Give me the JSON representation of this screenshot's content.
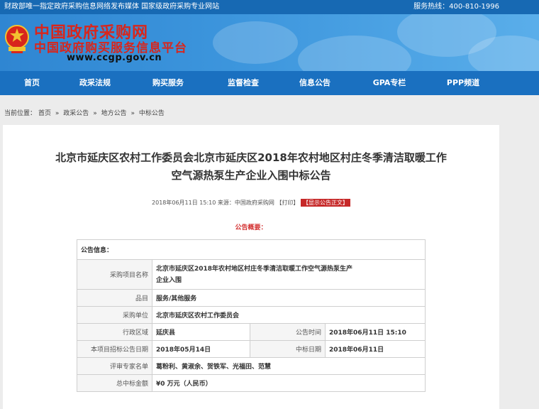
{
  "topbar": {
    "left_text": "财政部唯一指定政府采购信息网络发布媒体  国家级政府采购专业网站",
    "right_text": "服务热线：400-810-1996"
  },
  "logo": {
    "line1": "中国政府采购网",
    "line2": "中国政府购买服务信息平台",
    "url": "www.ccgp.gov.cn"
  },
  "nav": {
    "items": [
      "首页",
      "政采法规",
      "购买服务",
      "监督检查",
      "信息公告",
      "GPA专栏",
      "PPP频道"
    ]
  },
  "breadcrumb": {
    "prefix": "当前位置：",
    "items": [
      "首页",
      "政采公告",
      "地方公告",
      "中标公告"
    ],
    "separator": "»"
  },
  "article": {
    "title_line1": "北京市延庆区农村工作委员会北京市延庆区2018年农村地区村庄冬季清洁取暖工作",
    "title_line2": "空气源热泵生产企业入围中标公告",
    "datetime": "2018年06月11日 15:10",
    "source": "来源：中国政府采购网",
    "print_label": "【打印】",
    "show_body_label": "【显示公告正文】",
    "summary_heading": "公告概要："
  },
  "info_table": {
    "heading": "公告信息：",
    "project_name_label": "采购项目名称",
    "project_name_line1": "北京市延庆区2018年农村地区村庄冬季清洁取暖工作空气源热泵生产",
    "project_name_line2": "企业入围",
    "category_label": "品目",
    "category_value": "服务/其他服务",
    "purchaser_label": "采购单位",
    "purchaser_value": "北京市延庆区农村工作委员会",
    "district_label": "行政区域",
    "district_value": "延庆县",
    "announce_time_label": "公告时间",
    "announce_time_value": "2018年06月11日  15:10",
    "bid_date_label": "本项目招标公告日期",
    "bid_date_value": "2018年05月14日",
    "award_date_label": "中标日期",
    "award_date_value": "2018年06月11日",
    "experts_label": "评审专家名单",
    "experts_value": "葛粉利、黄淑余、贺铁军、光福田、范慧",
    "amount_label": "总中标金额",
    "amount_value": "¥0 万元（人民币）"
  },
  "colors": {
    "nav_blue": "#1a70c0",
    "logo_red": "#d8261c",
    "tag_red": "#c62828"
  }
}
